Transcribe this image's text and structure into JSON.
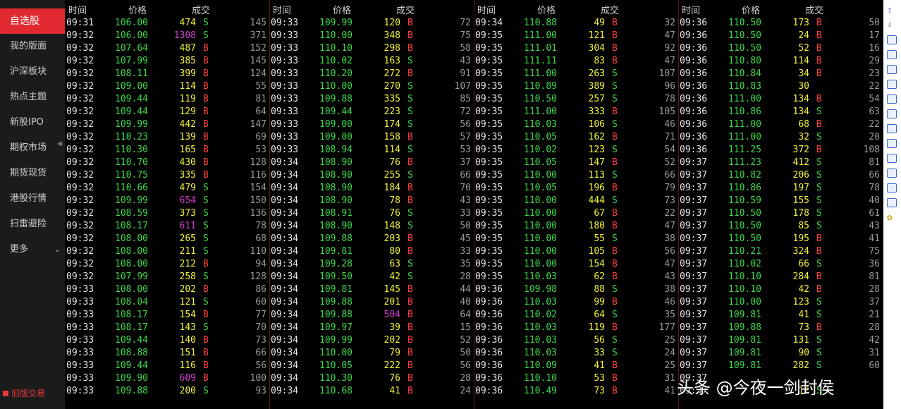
{
  "sidebar": {
    "items": [
      {
        "label": "自选股",
        "active": true
      },
      {
        "label": "我的版面"
      },
      {
        "label": "沪深板块"
      },
      {
        "label": "热点主题"
      },
      {
        "label": "新股IPO"
      },
      {
        "label": "期权市场"
      },
      {
        "label": "期货现货"
      },
      {
        "label": "港股行情"
      },
      {
        "label": "扫雷避险"
      },
      {
        "label": "更多"
      }
    ],
    "old_version_label": "旧版交易"
  },
  "headers": {
    "time": "时间",
    "price": "价格",
    "volume": "成交"
  },
  "columns": [
    {
      "rows": [
        [
          "09:31",
          "106.00",
          "474",
          "S",
          "145"
        ],
        [
          "09:32",
          "106.00",
          "1308",
          "S",
          "371"
        ],
        [
          "09:32",
          "107.64",
          "487",
          "B",
          "152"
        ],
        [
          "09:32",
          "107.99",
          "385",
          "B",
          "145"
        ],
        [
          "09:32",
          "108.11",
          "399",
          "B",
          "124"
        ],
        [
          "09:32",
          "109.00",
          "114",
          "B",
          "55"
        ],
        [
          "09:32",
          "109.44",
          "119",
          "B",
          "81"
        ],
        [
          "09:32",
          "109.44",
          "129",
          "B",
          "64"
        ],
        [
          "09:32",
          "109.99",
          "442",
          "B",
          "147"
        ],
        [
          "09:32",
          "110.23",
          "139",
          "B",
          "69"
        ],
        [
          "09:32",
          "110.30",
          "165",
          "B",
          "53"
        ],
        [
          "09:32",
          "110.70",
          "430",
          "B",
          "128"
        ],
        [
          "09:32",
          "110.75",
          "335",
          "B",
          "116"
        ],
        [
          "09:32",
          "110.66",
          "479",
          "S",
          "154"
        ],
        [
          "09:32",
          "109.99",
          "654",
          "S",
          "150"
        ],
        [
          "09:32",
          "108.59",
          "373",
          "S",
          "136"
        ],
        [
          "09:32",
          "108.17",
          "611",
          "S",
          "78"
        ],
        [
          "09:32",
          "108.00",
          "265",
          "S",
          "68"
        ],
        [
          "09:32",
          "108.00",
          "211",
          "S",
          "110"
        ],
        [
          "09:32",
          "108.00",
          "212",
          "B",
          "94"
        ],
        [
          "09:32",
          "107.99",
          "258",
          "S",
          "128"
        ],
        [
          "09:33",
          "108.00",
          "202",
          "B",
          "86"
        ],
        [
          "09:33",
          "108.04",
          "121",
          "S",
          "60"
        ],
        [
          "09:33",
          "108.17",
          "154",
          "B",
          "77"
        ],
        [
          "09:33",
          "108.17",
          "143",
          "S",
          "70"
        ],
        [
          "09:33",
          "109.44",
          "140",
          "B",
          "73"
        ],
        [
          "09:33",
          "108.88",
          "151",
          "B",
          "66"
        ],
        [
          "09:33",
          "109.44",
          "116",
          "B",
          "56"
        ],
        [
          "09:33",
          "109.90",
          "609",
          "B",
          "100"
        ],
        [
          "09:33",
          "109.88",
          "200",
          "S",
          "93"
        ]
      ]
    },
    {
      "rows": [
        [
          "09:33",
          "109.99",
          "120",
          "B",
          "72"
        ],
        [
          "09:33",
          "110.00",
          "348",
          "B",
          "75"
        ],
        [
          "09:33",
          "110.10",
          "298",
          "B",
          "58"
        ],
        [
          "09:33",
          "110.02",
          "163",
          "S",
          "43"
        ],
        [
          "09:33",
          "110.20",
          "272",
          "B",
          "91"
        ],
        [
          "09:33",
          "110.00",
          "270",
          "S",
          "107"
        ],
        [
          "09:33",
          "109.88",
          "335",
          "S",
          "85"
        ],
        [
          "09:33",
          "109.44",
          "223",
          "S",
          "72"
        ],
        [
          "09:33",
          "109.00",
          "174",
          "S",
          "56"
        ],
        [
          "09:33",
          "109.00",
          "158",
          "B",
          "57"
        ],
        [
          "09:33",
          "108.94",
          "114",
          "S",
          "53"
        ],
        [
          "09:34",
          "108.90",
          "76",
          "B",
          "37"
        ],
        [
          "09:34",
          "108.90",
          "255",
          "S",
          "66"
        ],
        [
          "09:34",
          "108.90",
          "184",
          "B",
          "70"
        ],
        [
          "09:34",
          "108.90",
          "78",
          "B",
          "43"
        ],
        [
          "09:34",
          "108.91",
          "76",
          "S",
          "33"
        ],
        [
          "09:34",
          "108.90",
          "148",
          "S",
          "50"
        ],
        [
          "09:34",
          "109.88",
          "203",
          "B",
          "45"
        ],
        [
          "09:34",
          "109.81",
          "80",
          "B",
          "33"
        ],
        [
          "09:34",
          "109.28",
          "63",
          "S",
          "35"
        ],
        [
          "09:34",
          "109.50",
          "42",
          "S",
          "28"
        ],
        [
          "09:34",
          "109.81",
          "145",
          "B",
          "44"
        ],
        [
          "09:34",
          "109.88",
          "201",
          "B",
          "40"
        ],
        [
          "09:34",
          "109.88",
          "504",
          "B",
          "64"
        ],
        [
          "09:34",
          "109.97",
          "39",
          "B",
          "15"
        ],
        [
          "09:34",
          "109.99",
          "202",
          "B",
          "52"
        ],
        [
          "09:34",
          "110.00",
          "79",
          "B",
          "50"
        ],
        [
          "09:34",
          "110.05",
          "222",
          "B",
          "56"
        ],
        [
          "09:34",
          "110.30",
          "76",
          "B",
          "28"
        ],
        [
          "09:34",
          "110.68",
          "41",
          "B",
          "24"
        ]
      ]
    },
    {
      "rows": [
        [
          "09:34",
          "110.88",
          "49",
          "B",
          "32"
        ],
        [
          "09:35",
          "111.00",
          "121",
          "B",
          "47"
        ],
        [
          "09:35",
          "111.01",
          "304",
          "B",
          "92"
        ],
        [
          "09:35",
          "111.11",
          "83",
          "B",
          "47"
        ],
        [
          "09:35",
          "111.00",
          "263",
          "S",
          "107"
        ],
        [
          "09:35",
          "110.89",
          "389",
          "S",
          "96"
        ],
        [
          "09:35",
          "110.50",
          "257",
          "S",
          "78"
        ],
        [
          "09:35",
          "111.00",
          "333",
          "B",
          "105"
        ],
        [
          "09:35",
          "110.03",
          "106",
          "S",
          "46"
        ],
        [
          "09:35",
          "110.05",
          "162",
          "B",
          "71"
        ],
        [
          "09:35",
          "110.02",
          "123",
          "S",
          "54"
        ],
        [
          "09:35",
          "110.05",
          "147",
          "B",
          "52"
        ],
        [
          "09:35",
          "110.00",
          "113",
          "S",
          "66"
        ],
        [
          "09:35",
          "110.05",
          "196",
          "B",
          "79"
        ],
        [
          "09:35",
          "110.00",
          "444",
          "S",
          "73"
        ],
        [
          "09:35",
          "110.00",
          "67",
          "B",
          "22"
        ],
        [
          "09:35",
          "110.00",
          "180",
          "B",
          "47"
        ],
        [
          "09:35",
          "110.00",
          "55",
          "S",
          "38"
        ],
        [
          "09:35",
          "110.00",
          "105",
          "B",
          "56"
        ],
        [
          "09:35",
          "110.00",
          "154",
          "B",
          "47"
        ],
        [
          "09:35",
          "110.03",
          "62",
          "B",
          "43"
        ],
        [
          "09:36",
          "109.98",
          "88",
          "S",
          "38"
        ],
        [
          "09:36",
          "110.03",
          "99",
          "B",
          "46"
        ],
        [
          "09:36",
          "110.02",
          "64",
          "S",
          "35"
        ],
        [
          "09:36",
          "110.03",
          "119",
          "B",
          "177"
        ],
        [
          "09:36",
          "110.03",
          "56",
          "S",
          "25"
        ],
        [
          "09:36",
          "110.03",
          "33",
          "S",
          "24"
        ],
        [
          "09:36",
          "110.09",
          "41",
          "B",
          "25"
        ],
        [
          "09:36",
          "110.10",
          "53",
          "B",
          "31"
        ],
        [
          "09:36",
          "110.49",
          "73",
          "B",
          "41"
        ]
      ]
    },
    {
      "rows": [
        [
          "09:36",
          "110.50",
          "173",
          "B",
          "50"
        ],
        [
          "09:36",
          "110.50",
          "24",
          "B",
          "17"
        ],
        [
          "09:36",
          "110.50",
          "52",
          "B",
          "16"
        ],
        [
          "09:36",
          "110.80",
          "114",
          "B",
          "29"
        ],
        [
          "09:36",
          "110.84",
          "34",
          "B",
          "23"
        ],
        [
          "09:36",
          "110.83",
          "30",
          "",
          "22"
        ],
        [
          "09:36",
          "111.00",
          "134",
          "B",
          "54"
        ],
        [
          "09:36",
          "110.86",
          "134",
          "S",
          "63"
        ],
        [
          "09:36",
          "111.00",
          "68",
          "B",
          "22"
        ],
        [
          "09:36",
          "111.00",
          "32",
          "S",
          "20"
        ],
        [
          "09:36",
          "111.25",
          "372",
          "B",
          "108"
        ],
        [
          "09:37",
          "111.23",
          "412",
          "S",
          "81"
        ],
        [
          "09:37",
          "110.82",
          "206",
          "S",
          "66"
        ],
        [
          "09:37",
          "110.86",
          "197",
          "S",
          "78"
        ],
        [
          "09:37",
          "110.59",
          "155",
          "S",
          "40"
        ],
        [
          "09:37",
          "110.50",
          "178",
          "S",
          "61"
        ],
        [
          "09:37",
          "110.50",
          "85",
          "S",
          "43"
        ],
        [
          "09:37",
          "110.50",
          "195",
          "B",
          "41"
        ],
        [
          "09:37",
          "110.21",
          "324",
          "B",
          "75"
        ],
        [
          "09:37",
          "110.02",
          "66",
          "S",
          "36"
        ],
        [
          "09:37",
          "110.10",
          "284",
          "B",
          "81"
        ],
        [
          "09:37",
          "110.10",
          "42",
          "B",
          "28"
        ],
        [
          "09:37",
          "110.00",
          "123",
          "S",
          "37"
        ],
        [
          "09:37",
          "109.81",
          "41",
          "S",
          "21"
        ],
        [
          "09:37",
          "109.88",
          "73",
          "B",
          "28"
        ],
        [
          "09:37",
          "109.81",
          "131",
          "S",
          "42"
        ],
        [
          "09:37",
          "109.81",
          "90",
          "S",
          "31"
        ],
        [
          "09:37",
          "109.81",
          "282",
          "S",
          "60"
        ],
        [
          "09:37",
          "",
          "",
          "",
          ""
        ],
        [
          "09:37",
          "",
          "12",
          "S",
          ""
        ]
      ]
    }
  ],
  "toolbar_icons": [
    "arrow-up-icon",
    "arrow-down-icon",
    "grid-icon",
    "table-icon",
    "chart-line-icon",
    "candlestick-icon",
    "list-icon",
    "f10-icon",
    "report-icon",
    "doc-icon",
    "bookmark-icon",
    "fiz-icon",
    "f10-alt-icon",
    "circle-icon",
    "gear-icon"
  ],
  "watermark": "头条 @今夜一剑封侯"
}
